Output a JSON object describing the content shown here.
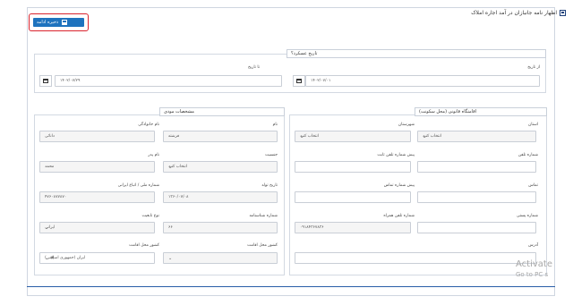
{
  "header": {
    "title": "اظهار نامه جانبازان در آمد اجاره املاک",
    "save_label": "ذخیره ادامه"
  },
  "date_section": {
    "title": "تاریخ عسکرد؟",
    "from_label": "از تاریخ",
    "from_value": "۱۴۰۲/۰۷/۰۱",
    "to_label": "تا تاریخ",
    "to_value": "۱۴۰۲/۰۷/۲۹"
  },
  "address_section": {
    "title": "اقامتگاه قانونی (محل سکونت)",
    "province_label": "استان",
    "province_value": "انتخاب کنید",
    "city_label": "شهرستان",
    "city_value": "انتخاب کنید",
    "landline_label": "شماره تلفن",
    "area_code_label": "پیش شماره تلفن ثابت",
    "mobile_label": "تماس",
    "mobile_prefix_label": "پیش شماره تماس",
    "postal_label": "شماره پستی",
    "phone_label": "شماره تلفن همراه",
    "phone_value": "۰۹۱۸۴۳۶۷۸۳۶",
    "address_label": "آدرس"
  },
  "personal_section": {
    "title": "مشخصات مودی",
    "first_name_label": "نام",
    "first_name_value": "فرشته",
    "last_name_label": "نام خانوادگی",
    "last_name_value": "دانائی",
    "gender_label": "جنسیت",
    "gender_value": "انتخاب کنید",
    "father_label": "نام پدر",
    "father_value": "محمد",
    "birth_label": "تاریخ تولد",
    "birth_value": "۱۳۶۰/۰۷/۰۸",
    "national_id_label": "شماره ملی / اتباع ایرانی",
    "national_id_value": "۴۷۶۰۸۷۷۸۷۰",
    "id_number_label": "شماره شناسنامه",
    "id_number_value": "۶۶",
    "citizen_type_label": "نوع تابعیت",
    "citizen_type_value": "ایرانی",
    "birth_country_label": "کشور محل اقامت",
    "birth_country_value": "",
    "country_label": "کشور محل اقامت",
    "country_value": "ایران (جمهوری اسلامی)"
  },
  "watermark": {
    "line1": "Activate",
    "line2": "Go to PC s"
  }
}
